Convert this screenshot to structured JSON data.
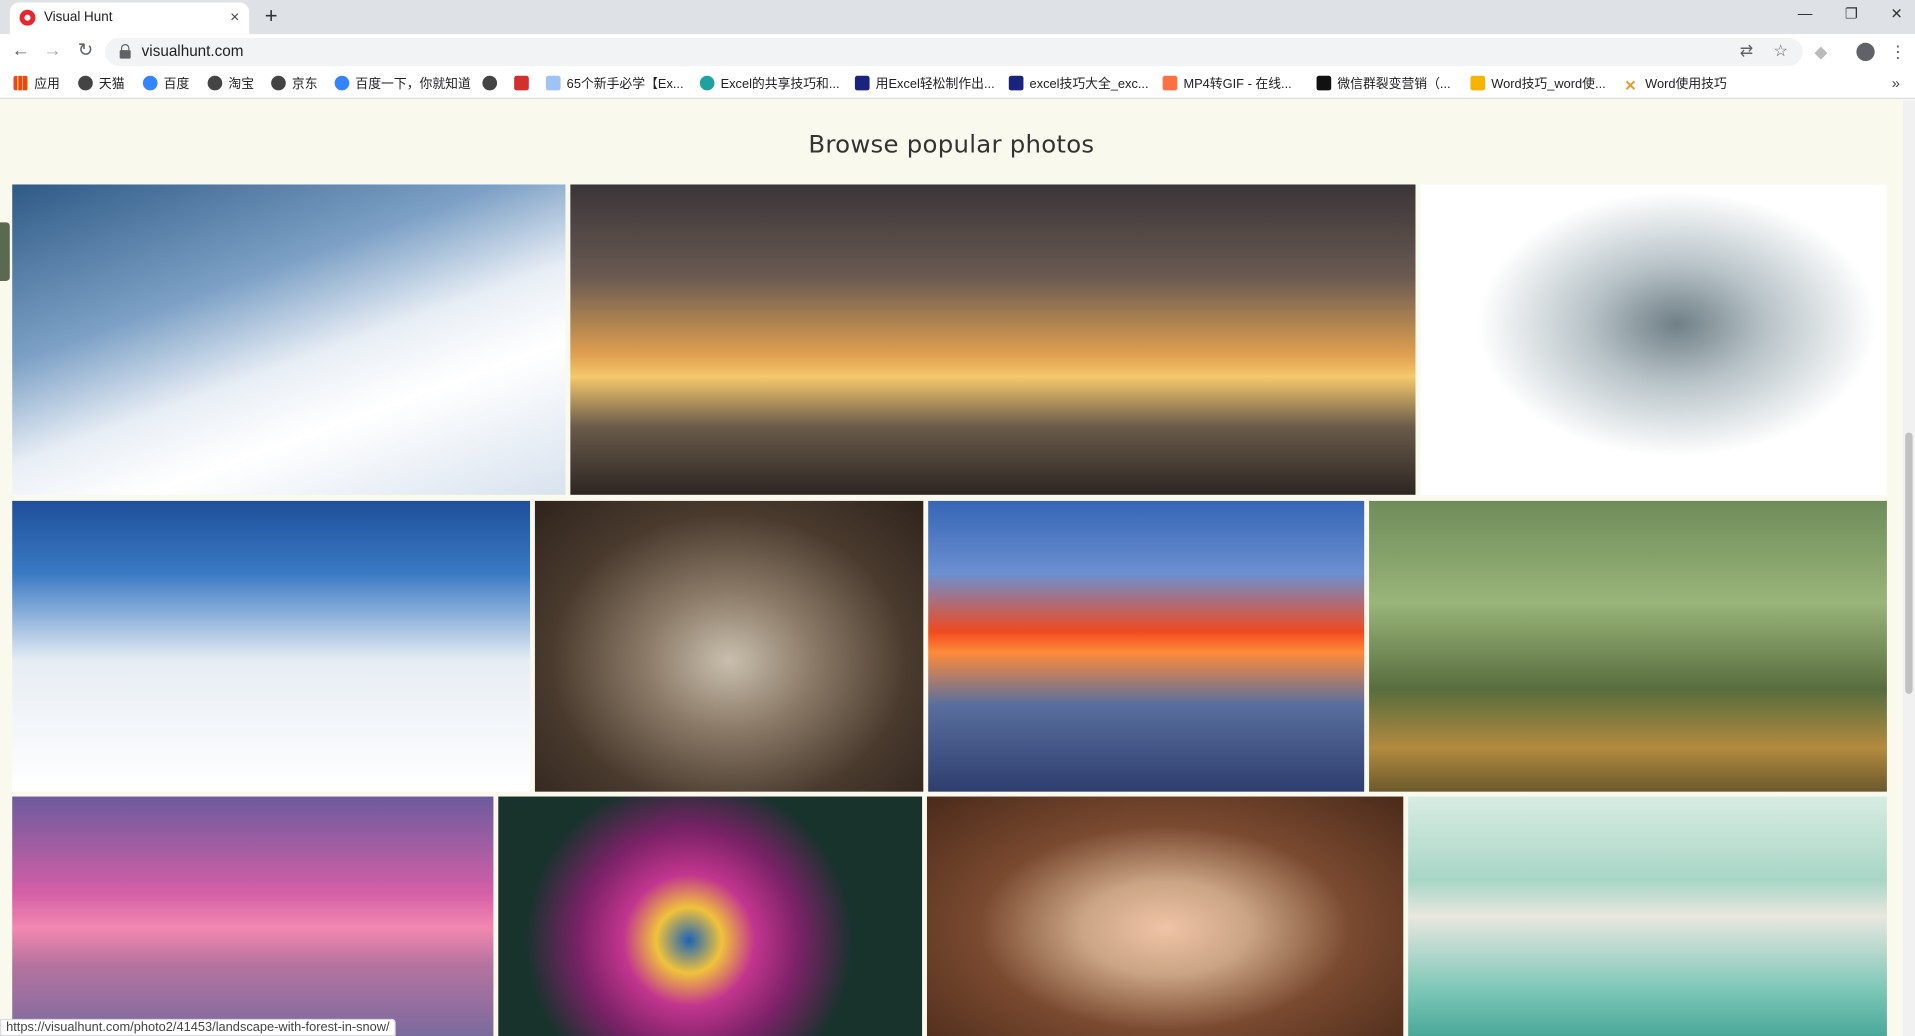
{
  "browser": {
    "tab_title": "Visual Hunt",
    "url": "visualhunt.com",
    "new_tab_label": "+",
    "close_tab_label": "×",
    "window_controls": [
      "—",
      "❐",
      "✕"
    ]
  },
  "bookmarks": [
    {
      "label": "应用",
      "icon": "apps-grid-icon"
    },
    {
      "label": "天猫",
      "icon": "globe-icon"
    },
    {
      "label": "百度",
      "icon": "baidu-paw-icon"
    },
    {
      "label": "淘宝",
      "icon": "globe-icon"
    },
    {
      "label": "京东",
      "icon": "globe-icon"
    },
    {
      "label": "百度一下，你就知道",
      "icon": "baidu-paw-icon"
    },
    {
      "label": "",
      "icon": "globe-icon"
    },
    {
      "label": "",
      "icon": "red-square-icon"
    },
    {
      "label": "65个新手必学【Ex...",
      "icon": "page-icon"
    },
    {
      "label": "Excel的共享技巧和...",
      "icon": "edge-icon"
    },
    {
      "label": "用Excel轻松制作出...",
      "icon": "bookmark-blue-icon"
    },
    {
      "label": "excel技巧大全_exc...",
      "icon": "bookmark-blue-icon"
    },
    {
      "label": "MP4转GIF - 在线...",
      "icon": "orange-icon"
    },
    {
      "label": "微信群裂变营销（...",
      "icon": "m-logo-icon"
    },
    {
      "label": "Word技巧_word使...",
      "icon": "yellow-icon"
    },
    {
      "label": "Word使用技巧",
      "icon": "cross-icon"
    }
  ],
  "bookmarks_more": "»",
  "page": {
    "heading": "Browse popular photos",
    "photos": [
      {
        "subject": "snowy fir trees on slope"
      },
      {
        "subject": "castle island at sunset"
      },
      {
        "subject": "black and white dancer pose"
      },
      {
        "subject": "snow covered forest under blue sky"
      },
      {
        "subject": "open book with glasses"
      },
      {
        "subject": "sunset reflected on lake reeds"
      },
      {
        "subject": "green forest with sunlight"
      },
      {
        "subject": "pink sunrise over lake with boat"
      },
      {
        "subject": "pink daisy flower"
      },
      {
        "subject": "child among autumn leaves"
      },
      {
        "subject": "woman with headscarf in car"
      }
    ]
  },
  "status_bar_url": "https://visualhunt.com/photo2/41453/landscape-with-forest-in-snow/"
}
